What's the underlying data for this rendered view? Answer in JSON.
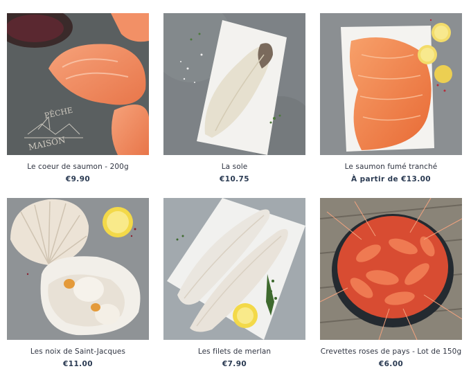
{
  "products": [
    {
      "name": "Le coeur de saumon - 200g",
      "price": "€9.90",
      "image": "salmon-fillet-on-slate",
      "brand_text": "PÊCHE MAISON"
    },
    {
      "name": "La sole",
      "price": "€10.75",
      "image": "sole-on-paper"
    },
    {
      "name": "Le saumon fumé tranché",
      "price": "À partir de €13.00",
      "image": "smoked-salmon-slices"
    },
    {
      "name": "Les noix de Saint-Jacques",
      "price": "€11.00",
      "image": "scallops-in-shell"
    },
    {
      "name": "Les filets de merlan",
      "price": "€7.90",
      "image": "whiting-fillets"
    },
    {
      "name": "Crevettes roses de pays - Lot de 150g",
      "price": "€6.00",
      "image": "pink-shrimp-bowl"
    }
  ],
  "colors": {
    "price_text": "#2a3a52",
    "name_text": "#2e3340",
    "salmon": "#f08a5d",
    "slate": "#6b7073"
  }
}
